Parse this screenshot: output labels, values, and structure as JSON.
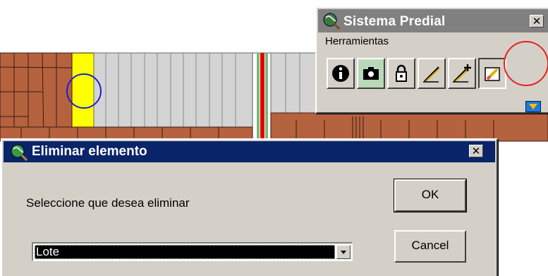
{
  "palette": {
    "title": "Sistema Predial",
    "group_label": "Herramientas",
    "tools": [
      {
        "icon": "info-icon"
      },
      {
        "icon": "camera-icon"
      },
      {
        "icon": "lock-icon"
      },
      {
        "icon": "pencil-icon"
      },
      {
        "icon": "add-line-icon"
      },
      {
        "icon": "eraser-icon"
      }
    ],
    "highlight_color": "#e82020"
  },
  "dialog": {
    "title": "Eliminar elemento",
    "prompt": "Seleccione que desea eliminar",
    "select_value": "Lote",
    "ok_label": "OK",
    "cancel_label": "Cancel"
  },
  "map": {
    "parcel_color": "#b5623e",
    "selected_parcel_color": "#ffff00",
    "road_color": "#e00000",
    "selection_circle_color": "#2020d0"
  }
}
